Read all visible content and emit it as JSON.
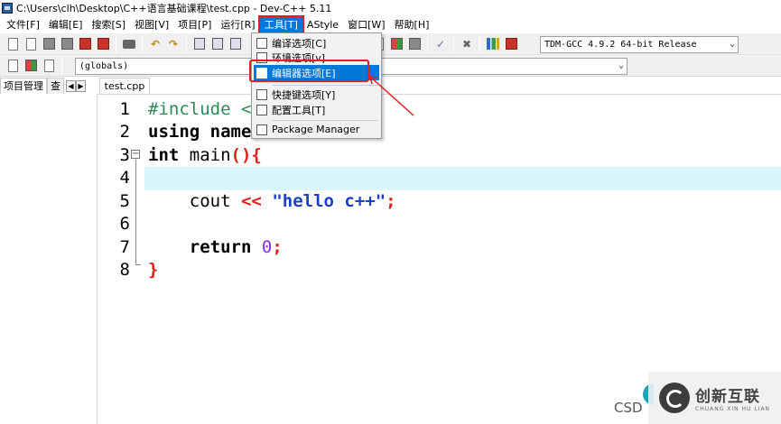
{
  "window": {
    "title": "C:\\Users\\clh\\Desktop\\C++语言基础课程\\test.cpp - Dev-C++ 5.11"
  },
  "menubar": [
    {
      "label": "文件[F]"
    },
    {
      "label": "编辑[E]"
    },
    {
      "label": "搜索[S]"
    },
    {
      "label": "视图[V]"
    },
    {
      "label": "项目[P]"
    },
    {
      "label": "运行[R]"
    },
    {
      "label": "工具[T]",
      "active": true
    },
    {
      "label": "AStyle"
    },
    {
      "label": "窗口[W]"
    },
    {
      "label": "帮助[H]"
    }
  ],
  "toolbar": {
    "compiler_select": "TDM-GCC 4.9.2 64-bit Release",
    "scope_select": "(globals)"
  },
  "tools_menu": {
    "items": [
      {
        "label": "编译选项[C]"
      },
      {
        "label": "环境选项[v]"
      },
      {
        "label": "编辑器选项[E]",
        "selected": true
      },
      {
        "label": "快捷键选项[Y]"
      },
      {
        "label": "配置工具[T]"
      },
      {
        "label": "Package Manager"
      }
    ]
  },
  "side_panel": {
    "tabs": [
      "项目管理",
      "查"
    ]
  },
  "editor": {
    "file_tab": "test.cpp",
    "line_numbers": [
      "1",
      "2",
      "3",
      "4",
      "5",
      "6",
      "7",
      "8"
    ],
    "lines": {
      "l1_directive": "#include <",
      "l2_using": "using",
      "l2_name": "name",
      "l3_type": "int",
      "l3_func": "main",
      "l3_paren": "(){",
      "l5_cout": "cout",
      "l5_op": "<<",
      "l5_str": "\"hello c++\"",
      "l5_semi": ";",
      "l7_return": "return",
      "l7_num": "0",
      "l7_semi": ";",
      "l8_brace": "}"
    },
    "highlight_line": 4
  },
  "watermark": {
    "csdn": "CSD",
    "brand": "创新互联",
    "brand_sub": "CHUANG XIN HU LIAN"
  },
  "colors": {
    "accent": "#0078d7",
    "annotation": "#e0201c",
    "current_line": "#d8f6fb"
  }
}
